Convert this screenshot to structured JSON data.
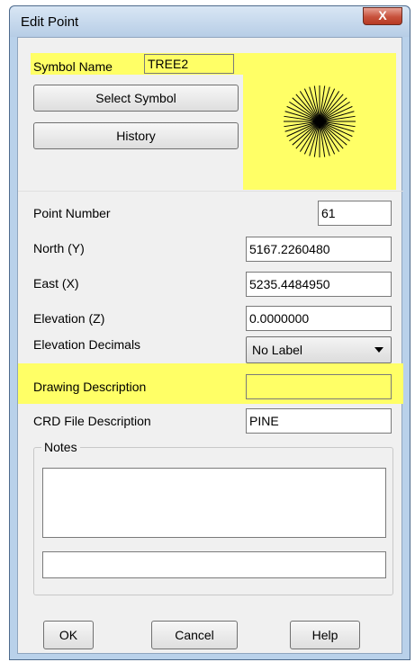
{
  "window": {
    "title": "Edit Point",
    "close_label": "X"
  },
  "symbol": {
    "name_label": "Symbol Name",
    "name_value": "TREE2",
    "select_button": "Select Symbol",
    "history_button": "History",
    "preview_icon": "tree-symbol-icon"
  },
  "fields": {
    "point_number": {
      "label": "Point Number",
      "value": "61"
    },
    "north": {
      "label": "North (Y)",
      "value": "5167.2260480"
    },
    "east": {
      "label": "East (X)",
      "value": "5235.4484950"
    },
    "elevation": {
      "label": "Elevation (Z)",
      "value": "0.0000000"
    },
    "elevation_decimals": {
      "label": "Elevation Decimals",
      "value": "No Label"
    },
    "drawing_description": {
      "label": "Drawing Description",
      "value": ""
    },
    "crd_description": {
      "label": "CRD File Description",
      "value": "PINE"
    }
  },
  "notes": {
    "legend": "Notes",
    "text": "",
    "line": ""
  },
  "buttons": {
    "ok": "OK",
    "cancel": "Cancel",
    "help": "Help"
  },
  "colors": {
    "highlight": "#ffff66",
    "dialog_bg": "#f0f0f0",
    "frame": "#b9d1ea"
  }
}
